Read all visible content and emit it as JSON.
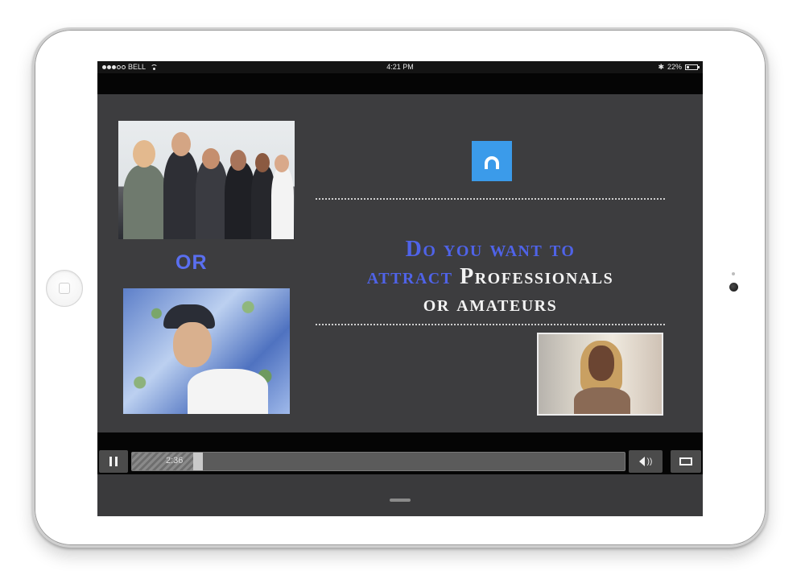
{
  "status_bar": {
    "carrier": "BELL",
    "time": "4:21 PM",
    "battery_percent": "22%",
    "battery_level": 0.22,
    "signal_icon": "signal-dots-icon",
    "wifi_icon": "wifi-icon",
    "bluetooth_icon": "bluetooth-icon",
    "bluetooth_glyph": "✱"
  },
  "slide": {
    "or_label": "OR",
    "headline_line1": "Do you want to",
    "headline_line2_blue": "attract ",
    "headline_line2_white": "Professionals",
    "headline_line3": "or amateurs",
    "accent_blue": "#4f63e8",
    "logo_color": "#3b9bea"
  },
  "player": {
    "current_time": "2:36",
    "progress_fraction": 0.13,
    "volume_glyph": "))"
  },
  "colors": {
    "screen_bg": "#3d3d3f",
    "bar_black": "#050505"
  }
}
